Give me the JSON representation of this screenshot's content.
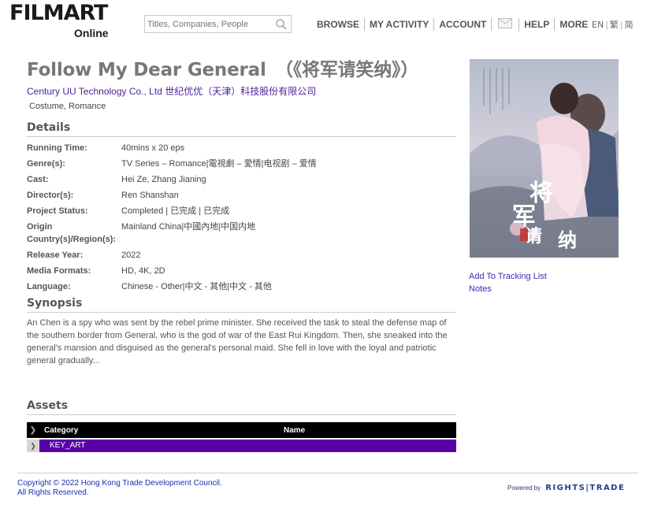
{
  "header": {
    "logo_main": "FILMART",
    "logo_sub": "Online",
    "search_placeholder": "Titles, Companies, People",
    "nav": [
      "BROWSE",
      "MY ACTIVITY",
      "ACCOUNT",
      "HELP",
      "MORE"
    ],
    "mail_icon": "mail-icon",
    "lang": {
      "en": "EN",
      "trad": "繁",
      "simp": "简"
    }
  },
  "title": {
    "text": "Follow My Dear General　（《将军请笑纳》）",
    "company": "Century UU Technology Co., Ltd 世纪优优（天津）科技股份有限公司",
    "genres": "Costume, Romance"
  },
  "details": {
    "heading": "Details",
    "rows": [
      {
        "label": "Running Time:",
        "value": "40mins x 20 eps"
      },
      {
        "label": "Genre(s):",
        "value": "TV Series – Romance|電視劇 – 愛情|电视剧 – 爱情"
      },
      {
        "label": "Cast:",
        "value": "Hei Ze, Zhang Jianing"
      },
      {
        "label": "Director(s):",
        "value": "Ren Shanshan"
      },
      {
        "label": "Project Status:",
        "value": "Completed | 已完成 | 已完成"
      },
      {
        "label": "Origin Country(s)/Region(s):",
        "value": "Mainland China|中國內地|中国内地"
      },
      {
        "label": "Release Year:",
        "value": "2022"
      },
      {
        "label": "Media Formats:",
        "value": "HD, 4K, 2D"
      },
      {
        "label": "Language:",
        "value": "Chinese - Other|中文 - 其他|中文 - 其他"
      }
    ]
  },
  "synopsis": {
    "heading": "Synopsis",
    "text": "An Chen is a spy who was sent by the rebel prime minister. She received the task to steal the defense map of the southern border from General, who is the god of war of the East Rui Kingdom. Then, she sneaked into the general's mansion and disguised as the general's personal maid. She fell in love with the loyal and patriotic general gradually..."
  },
  "assets": {
    "heading": "Assets",
    "columns": [
      "Category",
      "Name"
    ],
    "rows": [
      {
        "category": "KEY_ART"
      }
    ]
  },
  "sidebar": {
    "poster_title": "将军请笑纳",
    "track": "Add To Tracking List",
    "notes": "Notes"
  },
  "footer": {
    "copy_line1": "Copyright © 2022 Hong Kong Trade Development Council.",
    "copy_line2": "All Rights Reserved.",
    "powered_by": "Powered by",
    "brand": "RIGHTS|TRADE"
  },
  "colors": {
    "accent_purple": "#5a00a8",
    "link_purple": "#4b1f9a",
    "footer_blue": "#1a2fb0"
  }
}
